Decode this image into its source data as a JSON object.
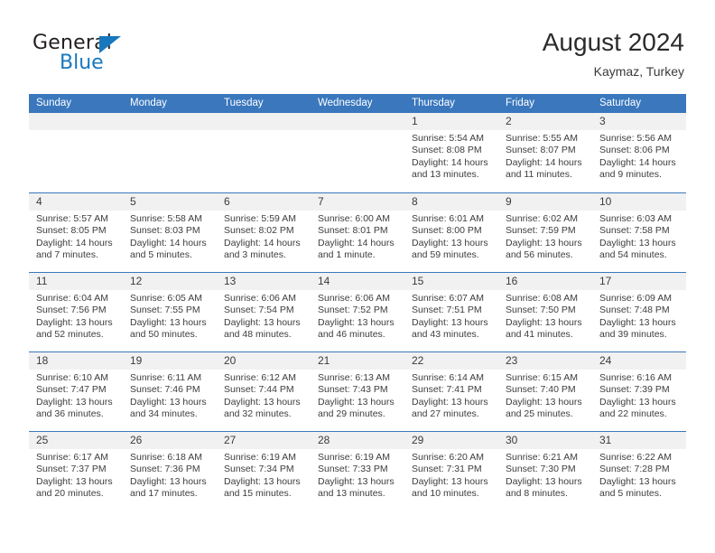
{
  "brand": {
    "name_top": "General",
    "name_bottom": "Blue",
    "triangle_color": "#1878be"
  },
  "header": {
    "title": "August 2024",
    "subtitle": "Kaymaz, Turkey"
  },
  "colors": {
    "header_row_background": "#3a77bd",
    "header_row_text": "#ffffff",
    "day_band_background": "#f1f1f1",
    "row_separator": "#3a77bd",
    "body_text": "#3d3d3d",
    "page_background": "#ffffff"
  },
  "weekdays": [
    "Sunday",
    "Monday",
    "Tuesday",
    "Wednesday",
    "Thursday",
    "Friday",
    "Saturday"
  ],
  "weeks": [
    [
      {
        "day": "",
        "empty": true,
        "sunrise": "",
        "sunset": "",
        "daylight_1": "",
        "daylight_2": ""
      },
      {
        "day": "",
        "empty": true,
        "sunrise": "",
        "sunset": "",
        "daylight_1": "",
        "daylight_2": ""
      },
      {
        "day": "",
        "empty": true,
        "sunrise": "",
        "sunset": "",
        "daylight_1": "",
        "daylight_2": ""
      },
      {
        "day": "",
        "empty": true,
        "sunrise": "",
        "sunset": "",
        "daylight_1": "",
        "daylight_2": ""
      },
      {
        "day": "1",
        "empty": false,
        "sunrise": "Sunrise: 5:54 AM",
        "sunset": "Sunset: 8:08 PM",
        "daylight_1": "Daylight: 14 hours",
        "daylight_2": "and 13 minutes."
      },
      {
        "day": "2",
        "empty": false,
        "sunrise": "Sunrise: 5:55 AM",
        "sunset": "Sunset: 8:07 PM",
        "daylight_1": "Daylight: 14 hours",
        "daylight_2": "and 11 minutes."
      },
      {
        "day": "3",
        "empty": false,
        "sunrise": "Sunrise: 5:56 AM",
        "sunset": "Sunset: 8:06 PM",
        "daylight_1": "Daylight: 14 hours",
        "daylight_2": "and 9 minutes."
      }
    ],
    [
      {
        "day": "4",
        "empty": false,
        "sunrise": "Sunrise: 5:57 AM",
        "sunset": "Sunset: 8:05 PM",
        "daylight_1": "Daylight: 14 hours",
        "daylight_2": "and 7 minutes."
      },
      {
        "day": "5",
        "empty": false,
        "sunrise": "Sunrise: 5:58 AM",
        "sunset": "Sunset: 8:03 PM",
        "daylight_1": "Daylight: 14 hours",
        "daylight_2": "and 5 minutes."
      },
      {
        "day": "6",
        "empty": false,
        "sunrise": "Sunrise: 5:59 AM",
        "sunset": "Sunset: 8:02 PM",
        "daylight_1": "Daylight: 14 hours",
        "daylight_2": "and 3 minutes."
      },
      {
        "day": "7",
        "empty": false,
        "sunrise": "Sunrise: 6:00 AM",
        "sunset": "Sunset: 8:01 PM",
        "daylight_1": "Daylight: 14 hours",
        "daylight_2": "and 1 minute."
      },
      {
        "day": "8",
        "empty": false,
        "sunrise": "Sunrise: 6:01 AM",
        "sunset": "Sunset: 8:00 PM",
        "daylight_1": "Daylight: 13 hours",
        "daylight_2": "and 59 minutes."
      },
      {
        "day": "9",
        "empty": false,
        "sunrise": "Sunrise: 6:02 AM",
        "sunset": "Sunset: 7:59 PM",
        "daylight_1": "Daylight: 13 hours",
        "daylight_2": "and 56 minutes."
      },
      {
        "day": "10",
        "empty": false,
        "sunrise": "Sunrise: 6:03 AM",
        "sunset": "Sunset: 7:58 PM",
        "daylight_1": "Daylight: 13 hours",
        "daylight_2": "and 54 minutes."
      }
    ],
    [
      {
        "day": "11",
        "empty": false,
        "sunrise": "Sunrise: 6:04 AM",
        "sunset": "Sunset: 7:56 PM",
        "daylight_1": "Daylight: 13 hours",
        "daylight_2": "and 52 minutes."
      },
      {
        "day": "12",
        "empty": false,
        "sunrise": "Sunrise: 6:05 AM",
        "sunset": "Sunset: 7:55 PM",
        "daylight_1": "Daylight: 13 hours",
        "daylight_2": "and 50 minutes."
      },
      {
        "day": "13",
        "empty": false,
        "sunrise": "Sunrise: 6:06 AM",
        "sunset": "Sunset: 7:54 PM",
        "daylight_1": "Daylight: 13 hours",
        "daylight_2": "and 48 minutes."
      },
      {
        "day": "14",
        "empty": false,
        "sunrise": "Sunrise: 6:06 AM",
        "sunset": "Sunset: 7:52 PM",
        "daylight_1": "Daylight: 13 hours",
        "daylight_2": "and 46 minutes."
      },
      {
        "day": "15",
        "empty": false,
        "sunrise": "Sunrise: 6:07 AM",
        "sunset": "Sunset: 7:51 PM",
        "daylight_1": "Daylight: 13 hours",
        "daylight_2": "and 43 minutes."
      },
      {
        "day": "16",
        "empty": false,
        "sunrise": "Sunrise: 6:08 AM",
        "sunset": "Sunset: 7:50 PM",
        "daylight_1": "Daylight: 13 hours",
        "daylight_2": "and 41 minutes."
      },
      {
        "day": "17",
        "empty": false,
        "sunrise": "Sunrise: 6:09 AM",
        "sunset": "Sunset: 7:48 PM",
        "daylight_1": "Daylight: 13 hours",
        "daylight_2": "and 39 minutes."
      }
    ],
    [
      {
        "day": "18",
        "empty": false,
        "sunrise": "Sunrise: 6:10 AM",
        "sunset": "Sunset: 7:47 PM",
        "daylight_1": "Daylight: 13 hours",
        "daylight_2": "and 36 minutes."
      },
      {
        "day": "19",
        "empty": false,
        "sunrise": "Sunrise: 6:11 AM",
        "sunset": "Sunset: 7:46 PM",
        "daylight_1": "Daylight: 13 hours",
        "daylight_2": "and 34 minutes."
      },
      {
        "day": "20",
        "empty": false,
        "sunrise": "Sunrise: 6:12 AM",
        "sunset": "Sunset: 7:44 PM",
        "daylight_1": "Daylight: 13 hours",
        "daylight_2": "and 32 minutes."
      },
      {
        "day": "21",
        "empty": false,
        "sunrise": "Sunrise: 6:13 AM",
        "sunset": "Sunset: 7:43 PM",
        "daylight_1": "Daylight: 13 hours",
        "daylight_2": "and 29 minutes."
      },
      {
        "day": "22",
        "empty": false,
        "sunrise": "Sunrise: 6:14 AM",
        "sunset": "Sunset: 7:41 PM",
        "daylight_1": "Daylight: 13 hours",
        "daylight_2": "and 27 minutes."
      },
      {
        "day": "23",
        "empty": false,
        "sunrise": "Sunrise: 6:15 AM",
        "sunset": "Sunset: 7:40 PM",
        "daylight_1": "Daylight: 13 hours",
        "daylight_2": "and 25 minutes."
      },
      {
        "day": "24",
        "empty": false,
        "sunrise": "Sunrise: 6:16 AM",
        "sunset": "Sunset: 7:39 PM",
        "daylight_1": "Daylight: 13 hours",
        "daylight_2": "and 22 minutes."
      }
    ],
    [
      {
        "day": "25",
        "empty": false,
        "sunrise": "Sunrise: 6:17 AM",
        "sunset": "Sunset: 7:37 PM",
        "daylight_1": "Daylight: 13 hours",
        "daylight_2": "and 20 minutes."
      },
      {
        "day": "26",
        "empty": false,
        "sunrise": "Sunrise: 6:18 AM",
        "sunset": "Sunset: 7:36 PM",
        "daylight_1": "Daylight: 13 hours",
        "daylight_2": "and 17 minutes."
      },
      {
        "day": "27",
        "empty": false,
        "sunrise": "Sunrise: 6:19 AM",
        "sunset": "Sunset: 7:34 PM",
        "daylight_1": "Daylight: 13 hours",
        "daylight_2": "and 15 minutes."
      },
      {
        "day": "28",
        "empty": false,
        "sunrise": "Sunrise: 6:19 AM",
        "sunset": "Sunset: 7:33 PM",
        "daylight_1": "Daylight: 13 hours",
        "daylight_2": "and 13 minutes."
      },
      {
        "day": "29",
        "empty": false,
        "sunrise": "Sunrise: 6:20 AM",
        "sunset": "Sunset: 7:31 PM",
        "daylight_1": "Daylight: 13 hours",
        "daylight_2": "and 10 minutes."
      },
      {
        "day": "30",
        "empty": false,
        "sunrise": "Sunrise: 6:21 AM",
        "sunset": "Sunset: 7:30 PM",
        "daylight_1": "Daylight: 13 hours",
        "daylight_2": "and 8 minutes."
      },
      {
        "day": "31",
        "empty": false,
        "sunrise": "Sunrise: 6:22 AM",
        "sunset": "Sunset: 7:28 PM",
        "daylight_1": "Daylight: 13 hours",
        "daylight_2": "and 5 minutes."
      }
    ]
  ]
}
